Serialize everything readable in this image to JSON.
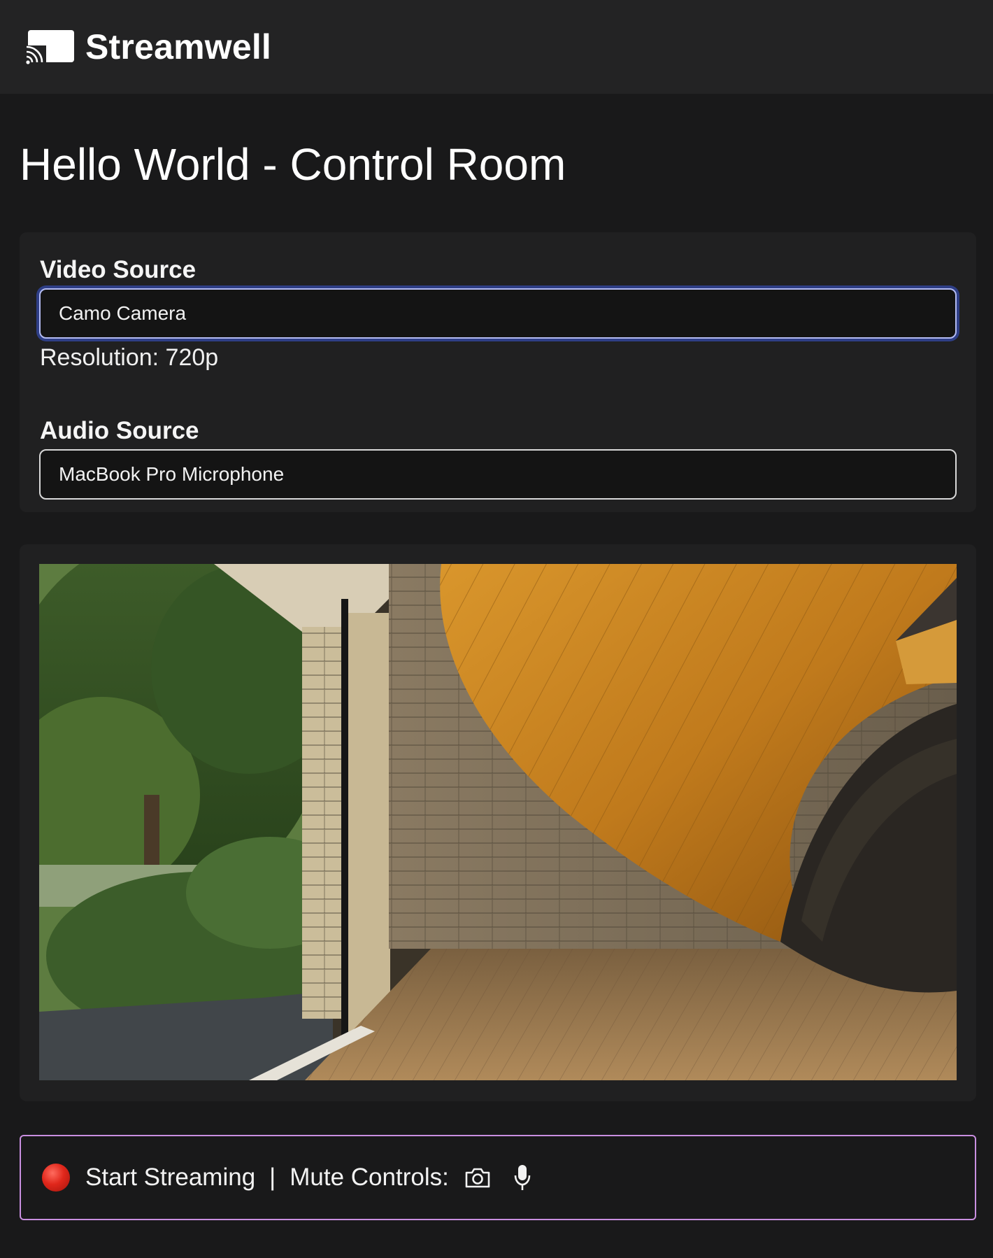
{
  "app": {
    "brand": "Streamwell",
    "logo_icon": "cast-icon"
  },
  "page": {
    "title": "Hello World - Control Room"
  },
  "sources": {
    "video_label": "Video Source",
    "video_value": "Camo Camera",
    "resolution_text": "Resolution: 720p",
    "audio_label": "Audio Source",
    "audio_value": "MacBook Pro Microphone"
  },
  "preview": {
    "content": "camera-preview-image"
  },
  "controls": {
    "record_icon": "red-circle-icon",
    "start_label": "Start Streaming",
    "separator": "|",
    "mute_label": "Mute Controls:",
    "camera_icon": "camera-icon",
    "mic_icon": "microphone-icon"
  },
  "colors": {
    "background": "#19191a",
    "header": "#232324",
    "card": "#202021",
    "focus_ring": "#2e3e86",
    "controls_border": "#c98fe0",
    "record": "#e0271b"
  }
}
